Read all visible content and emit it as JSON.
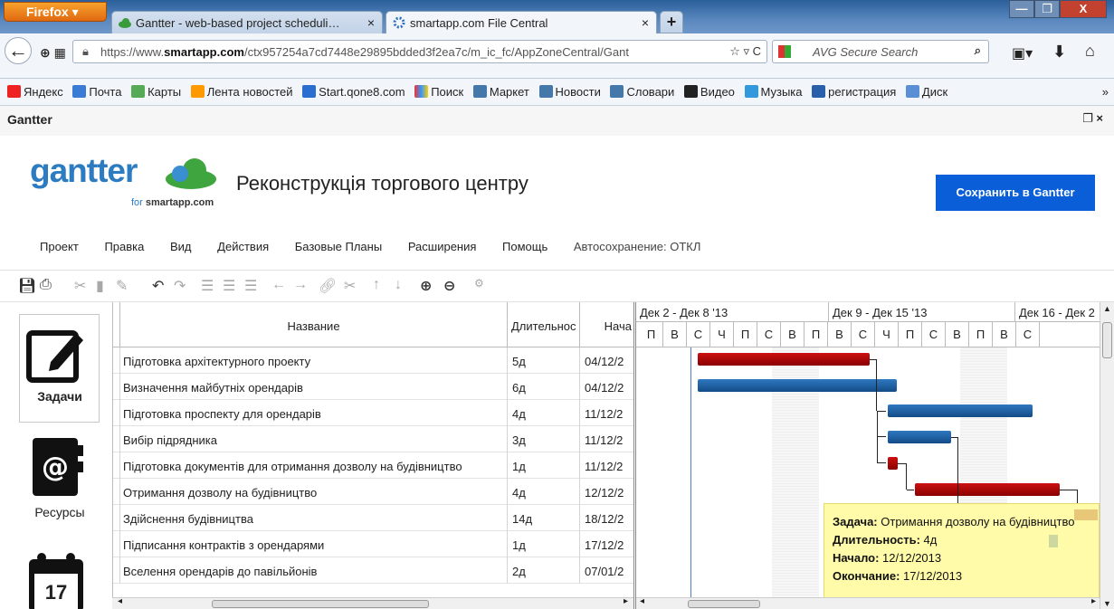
{
  "browser": {
    "menu_button": "Firefox",
    "tabs": [
      {
        "label": "Gantter - web-based project scheduli…"
      },
      {
        "label": "smartapp.com File Central"
      }
    ],
    "url_prefix": "https://www.",
    "url_domain": "smartapp.com",
    "url_rest": "/ctx957254a7cd7448e29895bdded3f2ea7c/m_ic_fc/AppZoneCentral/Gant",
    "search_placeholder": "AVG Secure Search",
    "bookmarks": [
      "Яндекс",
      "Почта",
      "Карты",
      "Лента новостей",
      "Start.qone8.com",
      "Поиск",
      "Маркет",
      "Новости",
      "Словари",
      "Видео",
      "Музыка",
      "регистрация",
      "Диск"
    ]
  },
  "app": {
    "window_title": "Gantter",
    "logo": "gantter",
    "logo_for": "for ",
    "logo_brand": "smartapp.com",
    "project_title": "Реконструкція торгового центру",
    "save_button": "Сохранить в Gantter",
    "menu": [
      "Проект",
      "Правка",
      "Вид",
      "Действия",
      "Базовые Планы",
      "Расширения",
      "Помощь",
      "Автосохранение: ОТКЛ"
    ]
  },
  "leftnav": {
    "tasks": "Задачи",
    "resources": "Ресурсы",
    "calendar_day": "17"
  },
  "grid": {
    "headers": {
      "name": "Название",
      "duration": "Длительнос",
      "start": "Нача"
    },
    "rows": [
      {
        "name": "Підготовка архітектурного проекту",
        "duration": "5д",
        "start": "04/12/2"
      },
      {
        "name": "Визначення майбутніх орендарів",
        "duration": "6д",
        "start": "04/12/2"
      },
      {
        "name": "Підготовка проспекту для орендарів",
        "duration": "4д",
        "start": "11/12/2"
      },
      {
        "name": "Вибір підрядника",
        "duration": "3д",
        "start": "11/12/2"
      },
      {
        "name": "Підготовка документів для отримання дозволу на будівництво",
        "duration": "1д",
        "start": "11/12/2"
      },
      {
        "name": "Отримання дозволу на будівництво",
        "duration": "4д",
        "start": "12/12/2"
      },
      {
        "name": "Здійснення будівництва",
        "duration": "14д",
        "start": "18/12/2"
      },
      {
        "name": "Підписання контрактів з орендарями",
        "duration": "1д",
        "start": "17/12/2"
      },
      {
        "name": "Вселення орендарів до павільйонів",
        "duration": "2д",
        "start": "07/01/2"
      }
    ]
  },
  "chart": {
    "weeks": [
      "Дек 2 - Дек 8 '13",
      "Дек 9 - Дек 15 '13",
      "Дек 16 - Дек 2"
    ],
    "days": [
      "П",
      "В",
      "С",
      "Ч",
      "П",
      "С",
      "В",
      "П",
      "В",
      "С",
      "Ч",
      "П",
      "С",
      "В",
      "П",
      "В",
      "С"
    ]
  },
  "tooltip": {
    "task_label": "Задача:",
    "task_value": " Отримання дозволу на будівництво",
    "duration_label": "Длительность:",
    "duration_value": " 4д",
    "start_label": "Начало:",
    "start_value": " 12/12/2013",
    "end_label": "Окончание:",
    "end_value": " 17/12/2013"
  },
  "colors": {
    "critical": "#8a0000",
    "normal": "#134c88",
    "accent": "#0a5fd8",
    "tooltip_bg": "#fffba8"
  }
}
